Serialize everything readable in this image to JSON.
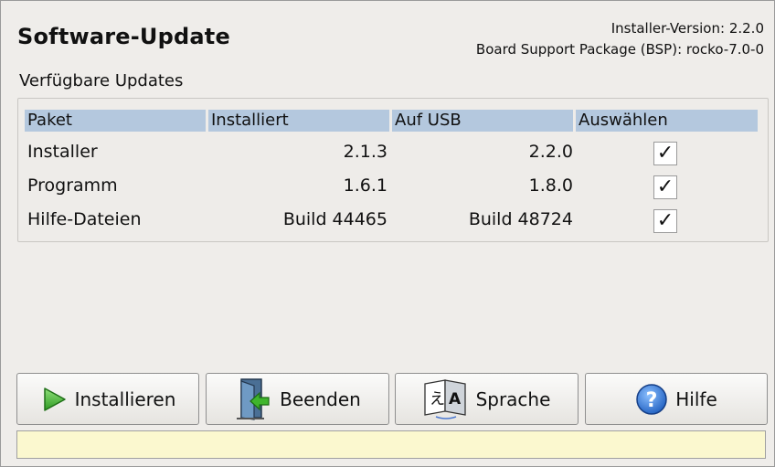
{
  "header": {
    "title": "Software-Update",
    "installer_version_label": "Installer-Version:",
    "installer_version_value": "2.2.0",
    "bsp_label": "Board Support Package (BSP):",
    "bsp_value": "rocko-7.0-0"
  },
  "updates": {
    "section_label": "Verfügbare Updates",
    "columns": [
      "Paket",
      "Installiert",
      "Auf USB",
      "Auswählen"
    ],
    "rows": [
      {
        "package": "Installer",
        "installed": "2.1.3",
        "usb": "2.2.0",
        "selected": true,
        "check": "✓"
      },
      {
        "package": "Programm",
        "installed": "1.6.1",
        "usb": "1.8.0",
        "selected": true,
        "check": "✓"
      },
      {
        "package": "Hilfe-Dateien",
        "installed": "Build 44465",
        "usb": "Build 48724",
        "selected": true,
        "check": "✓"
      }
    ]
  },
  "buttons": {
    "install": "Installieren",
    "quit": "Beenden",
    "language": "Sprache",
    "help": "Hilfe"
  },
  "icons": {
    "install": "play-icon",
    "quit": "exit-door-icon",
    "language": "translate-icon",
    "help": "help-icon"
  },
  "status": {
    "text": ""
  },
  "colors": {
    "header_bg": "#b4c8de",
    "status_bg": "#fbf8cf",
    "play_green": "#3aa52c",
    "help_blue": "#2f72c8"
  }
}
